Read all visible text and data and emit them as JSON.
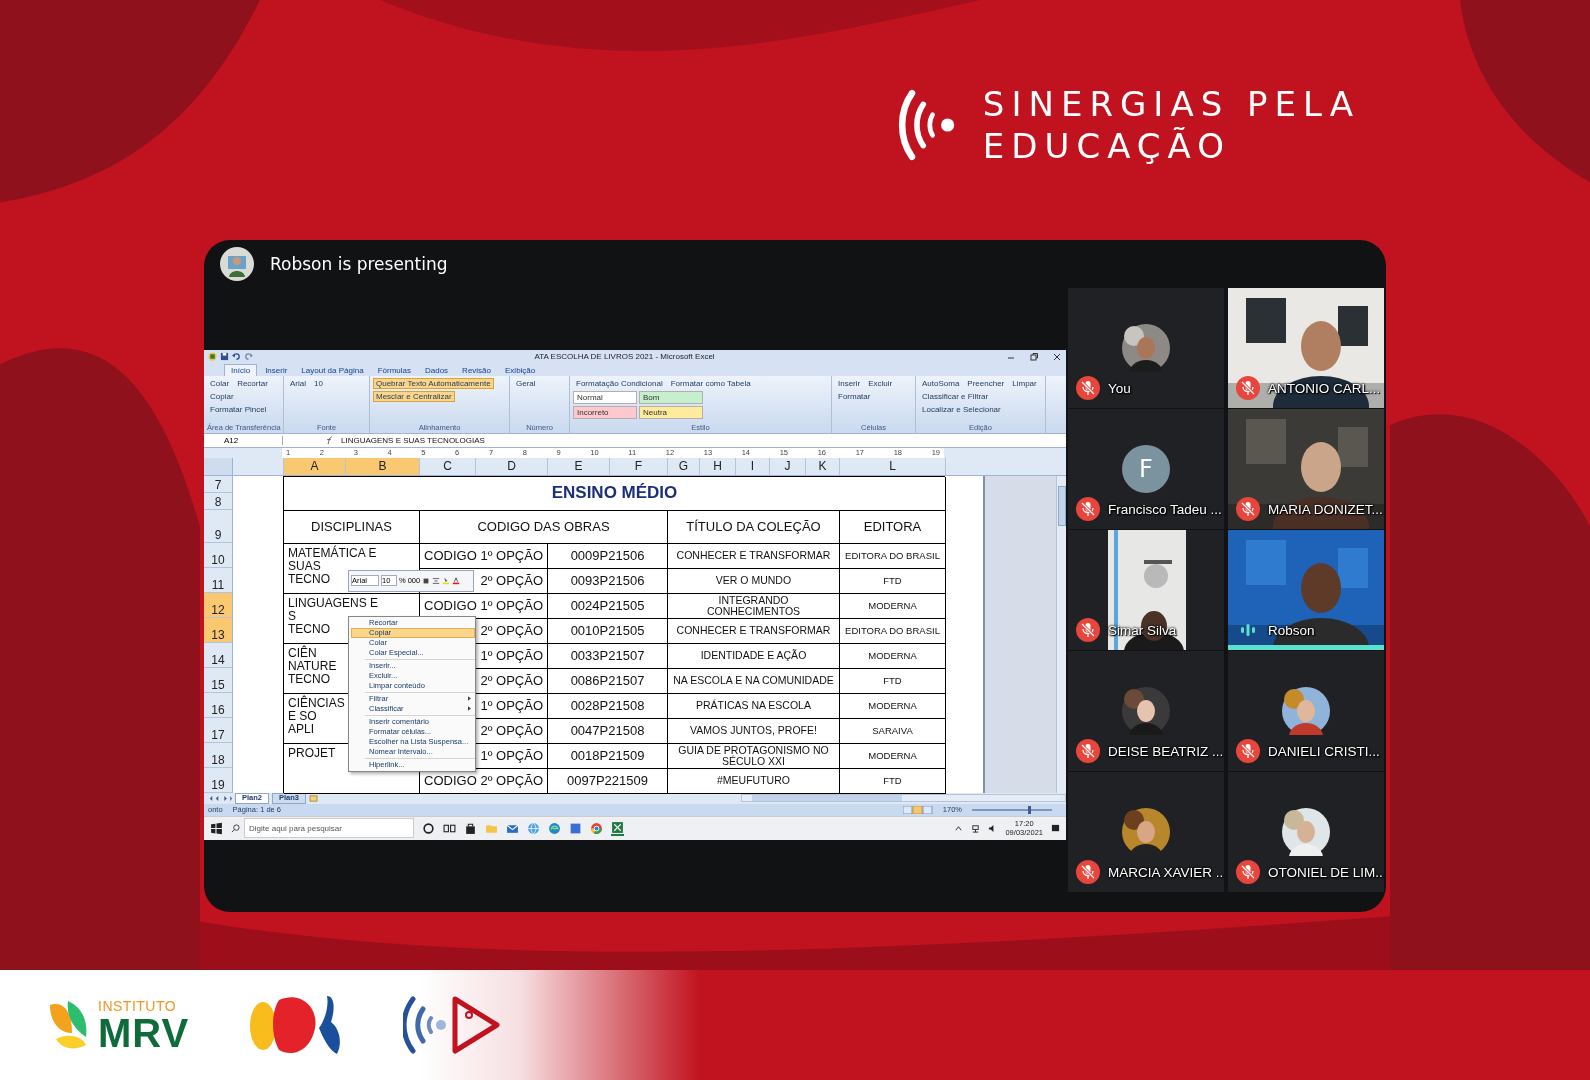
{
  "logo": {
    "line1": "SINERGIAS PELA",
    "line2": "EDUCAÇÃO"
  },
  "meeting": {
    "presenting": "Robson is presenting"
  },
  "excel": {
    "title": "ATA ESCOLHA DE LIVROS 2021 - Microsoft Excel",
    "tabs": [
      {
        "label": "Início",
        "selected": true
      },
      {
        "label": "Inserir",
        "selected": false
      },
      {
        "label": "Layout da Página",
        "selected": false
      },
      {
        "label": "Fórmulas",
        "selected": false
      },
      {
        "label": "Dados",
        "selected": false
      },
      {
        "label": "Revisão",
        "selected": false
      },
      {
        "label": "Exibição",
        "selected": false
      }
    ],
    "ribbon": [
      {
        "label": "Área de Transferência",
        "items": [
          {
            "label": "Colar",
            "on": false
          },
          {
            "label": "Recortar",
            "on": false
          },
          {
            "label": "Copiar",
            "on": false
          },
          {
            "label": "Formatar Pincel",
            "on": false
          }
        ]
      },
      {
        "label": "Fonte",
        "items": [
          {
            "label": "Arial",
            "on": false
          },
          {
            "label": "10",
            "on": false
          }
        ]
      },
      {
        "label": "Alinhamento",
        "items": [
          {
            "label": "Quebrar Texto Automaticamente",
            "on": true
          },
          {
            "label": "Mesclar e Centralizar",
            "on": true
          }
        ]
      },
      {
        "label": "Número",
        "items": [
          {
            "label": "Geral",
            "on": false
          }
        ]
      },
      {
        "label": "Estilo",
        "items": [
          {
            "label": "Formatação Condicional",
            "on": false
          },
          {
            "label": "Formatar como Tabela",
            "on": false
          }
        ],
        "styles": [
          {
            "label": "Normal",
            "color": "#ffffff"
          },
          {
            "label": "Bom",
            "color": "#c6efce"
          },
          {
            "label": "Incorreto",
            "color": "#ffc7ce"
          },
          {
            "label": "Neutra",
            "color": "#ffeb9c"
          }
        ]
      },
      {
        "label": "Células",
        "items": [
          {
            "label": "Inserir",
            "on": false
          },
          {
            "label": "Excluir",
            "on": false
          },
          {
            "label": "Formatar",
            "on": false
          }
        ]
      },
      {
        "label": "Edição",
        "items": [
          {
            "label": "AutoSoma",
            "on": false
          },
          {
            "label": "Preencher",
            "on": false
          },
          {
            "label": "Limpar",
            "on": false
          },
          {
            "label": "Classificar e Filtrar",
            "on": false
          },
          {
            "label": "Localizar e Selecionar",
            "on": false
          }
        ]
      }
    ],
    "name_box": "A12",
    "formula": "LINGUAGENS E SUAS TECNOLOGIAS",
    "ruler": [
      "1",
      "2",
      "3",
      "4",
      "5",
      "6",
      "7",
      "8",
      "9",
      "10",
      "11",
      "12",
      "13",
      "14",
      "15",
      "16",
      "17",
      "18",
      "19"
    ],
    "columns": [
      {
        "label": "A",
        "selected": true
      },
      {
        "label": "B",
        "selected": true
      },
      {
        "label": "C",
        "selected": false
      },
      {
        "label": "D",
        "selected": false
      },
      {
        "label": "E",
        "selected": false
      },
      {
        "label": "F",
        "selected": false
      },
      {
        "label": "G",
        "selected": false
      },
      {
        "label": "H",
        "selected": false
      },
      {
        "label": "I",
        "selected": false
      },
      {
        "label": "J",
        "selected": false
      },
      {
        "label": "K",
        "selected": false
      },
      {
        "label": "L",
        "selected": false
      }
    ],
    "row_numbers": [
      {
        "label": "7",
        "selected": false
      },
      {
        "label": "8",
        "selected": false
      },
      {
        "label": "9",
        "selected": false
      },
      {
        "label": "10",
        "selected": false
      },
      {
        "label": "11",
        "selected": false
      },
      {
        "label": "12",
        "selected": true
      },
      {
        "label": "13",
        "selected": true
      },
      {
        "label": "14",
        "selected": false
      },
      {
        "label": "15",
        "selected": false
      },
      {
        "label": "16",
        "selected": false
      },
      {
        "label": "17",
        "selected": false
      },
      {
        "label": "18",
        "selected": false
      },
      {
        "label": "19",
        "selected": false
      }
    ],
    "sheet": {
      "title": "ENSINO MÉDIO",
      "headers": [
        "DISCIPLINAS",
        "CODIGO DAS OBRAS",
        "TÍTULO DA COLEÇÃO",
        "EDITORA"
      ],
      "disciplines": [
        "MATEMÁTICA E\nSUAS\nTECNO",
        "LINGUAGENS E\nS\nTECNO",
        "CIÊN\nNATURE\nTECNO",
        "CIÊNCIAS\nE SO\nAPLI",
        "PROJET"
      ],
      "rows": [
        {
          "code_label": "CODIGO 1º OPÇÃO",
          "code": "0009P21506",
          "title": "CONHECER E TRANSFORMAR",
          "publisher": "EDITORA DO BRASIL"
        },
        {
          "code_label": "2º OPÇÃO",
          "code": "0093P21506",
          "title": "VER O MUNDO",
          "publisher": "FTD"
        },
        {
          "code_label": "CODIGO 1º OPÇÃO",
          "code": "0024P21505",
          "title": "INTEGRANDO CONHECIMENTOS",
          "publisher": "MODERNA"
        },
        {
          "code_label": "2º OPÇÃO",
          "code": "0010P21505",
          "title": "CONHECER E TRANSFORMAR",
          "publisher": "EDITORA DO BRASIL"
        },
        {
          "code_label": "1º OPÇÃO",
          "code": "0033P21507",
          "title": "IDENTIDADE E AÇÃO",
          "publisher": "MODERNA"
        },
        {
          "code_label": "2º OPÇÃO",
          "code": "0086P21507",
          "title": "NA ESCOLA E NA COMUNIDADE",
          "publisher": "FTD"
        },
        {
          "code_label": "1º OPÇÃO",
          "code": "0028P21508",
          "title": "PRÁTICAS NA ESCOLA",
          "publisher": "MODERNA"
        },
        {
          "code_label": "2º OPÇÃO",
          "code": "0047P21508",
          "title": "VAMOS JUNTOS, PROFE!",
          "publisher": "SARAIVA"
        },
        {
          "code_label": "1º OPÇÃO",
          "code": "0018P21509",
          "title": "GUIA DE PROTAGONISMO NO SÉCULO XXI",
          "publisher": "MODERNA"
        },
        {
          "code_label": "CODIGO 2º OPÇÃO",
          "code": "0097P221509",
          "title": "#MEUFUTURO",
          "publisher": "FTD"
        }
      ]
    },
    "mini_toolbar": {
      "font": "Arial",
      "size": "10",
      "percent": "%",
      "thousands": "000"
    },
    "context_menu": [
      {
        "kind": "item",
        "label": "Recortar",
        "selected": false
      },
      {
        "kind": "item",
        "label": "Copiar",
        "selected": true
      },
      {
        "kind": "item",
        "label": "Colar",
        "selected": false
      },
      {
        "kind": "item",
        "label": "Colar Especial...",
        "selected": false
      },
      {
        "kind": "separator"
      },
      {
        "kind": "item",
        "label": "Inserir...",
        "selected": false
      },
      {
        "kind": "item",
        "label": "Excluir...",
        "selected": false
      },
      {
        "kind": "item",
        "label": "Limpar conteúdo",
        "selected": false
      },
      {
        "kind": "separator"
      },
      {
        "kind": "submenu",
        "label": "Filtrar",
        "selected": false
      },
      {
        "kind": "submenu",
        "label": "Classificar",
        "selected": false
      },
      {
        "kind": "separator"
      },
      {
        "kind": "item",
        "label": "Inserir comentário",
        "selected": false
      },
      {
        "kind": "item",
        "label": "Formatar células...",
        "selected": false
      },
      {
        "kind": "item",
        "label": "Escolher na Lista Suspensa...",
        "selected": false
      },
      {
        "kind": "item",
        "label": "Nomear Intervalo...",
        "selected": false
      },
      {
        "kind": "separator"
      },
      {
        "kind": "item",
        "label": "Hiperlink...",
        "selected": false
      }
    ],
    "sheet_tabs": [
      {
        "label": "Plan2",
        "selected": true
      },
      {
        "label": "Plan3",
        "selected": false
      }
    ],
    "status": {
      "text": "onto",
      "page": "Página: 1 de 6",
      "zoom": "170%",
      "level": 0.7
    },
    "taskbar": {
      "placeholder": "Digite aqui para pesquisar",
      "time": "17:20",
      "date": "09/03/2021"
    }
  },
  "participants": [
    {
      "name": "You",
      "kind": "avatar",
      "muted": true,
      "speaking": false
    },
    {
      "name": "ANTONIO CARL...",
      "kind": "video",
      "muted": true,
      "speaking": false
    },
    {
      "name": "Francisco Tadeu ...",
      "kind": "letter",
      "letter": "F",
      "muted": true,
      "speaking": false
    },
    {
      "name": "MARIA DONIZET...",
      "kind": "video",
      "muted": true,
      "speaking": false
    },
    {
      "name": "Simar Silva",
      "kind": "portrait",
      "muted": true,
      "speaking": false
    },
    {
      "name": "Robson",
      "kind": "video",
      "muted": false,
      "speaking": true
    },
    {
      "name": "DEISE BEATRIZ ...",
      "kind": "avatar",
      "muted": true,
      "speaking": false
    },
    {
      "name": "DANIELI CRISTI...",
      "kind": "avatar",
      "muted": true,
      "speaking": false
    },
    {
      "name": "MARCIA XAVIER ...",
      "kind": "avatar",
      "muted": true,
      "speaking": false
    },
    {
      "name": "OTONIEL DE LIM...",
      "kind": "avatar",
      "muted": true,
      "speaking": false
    }
  ],
  "footer": {
    "institute": "INSTITUTO",
    "brand": "MRV"
  }
}
